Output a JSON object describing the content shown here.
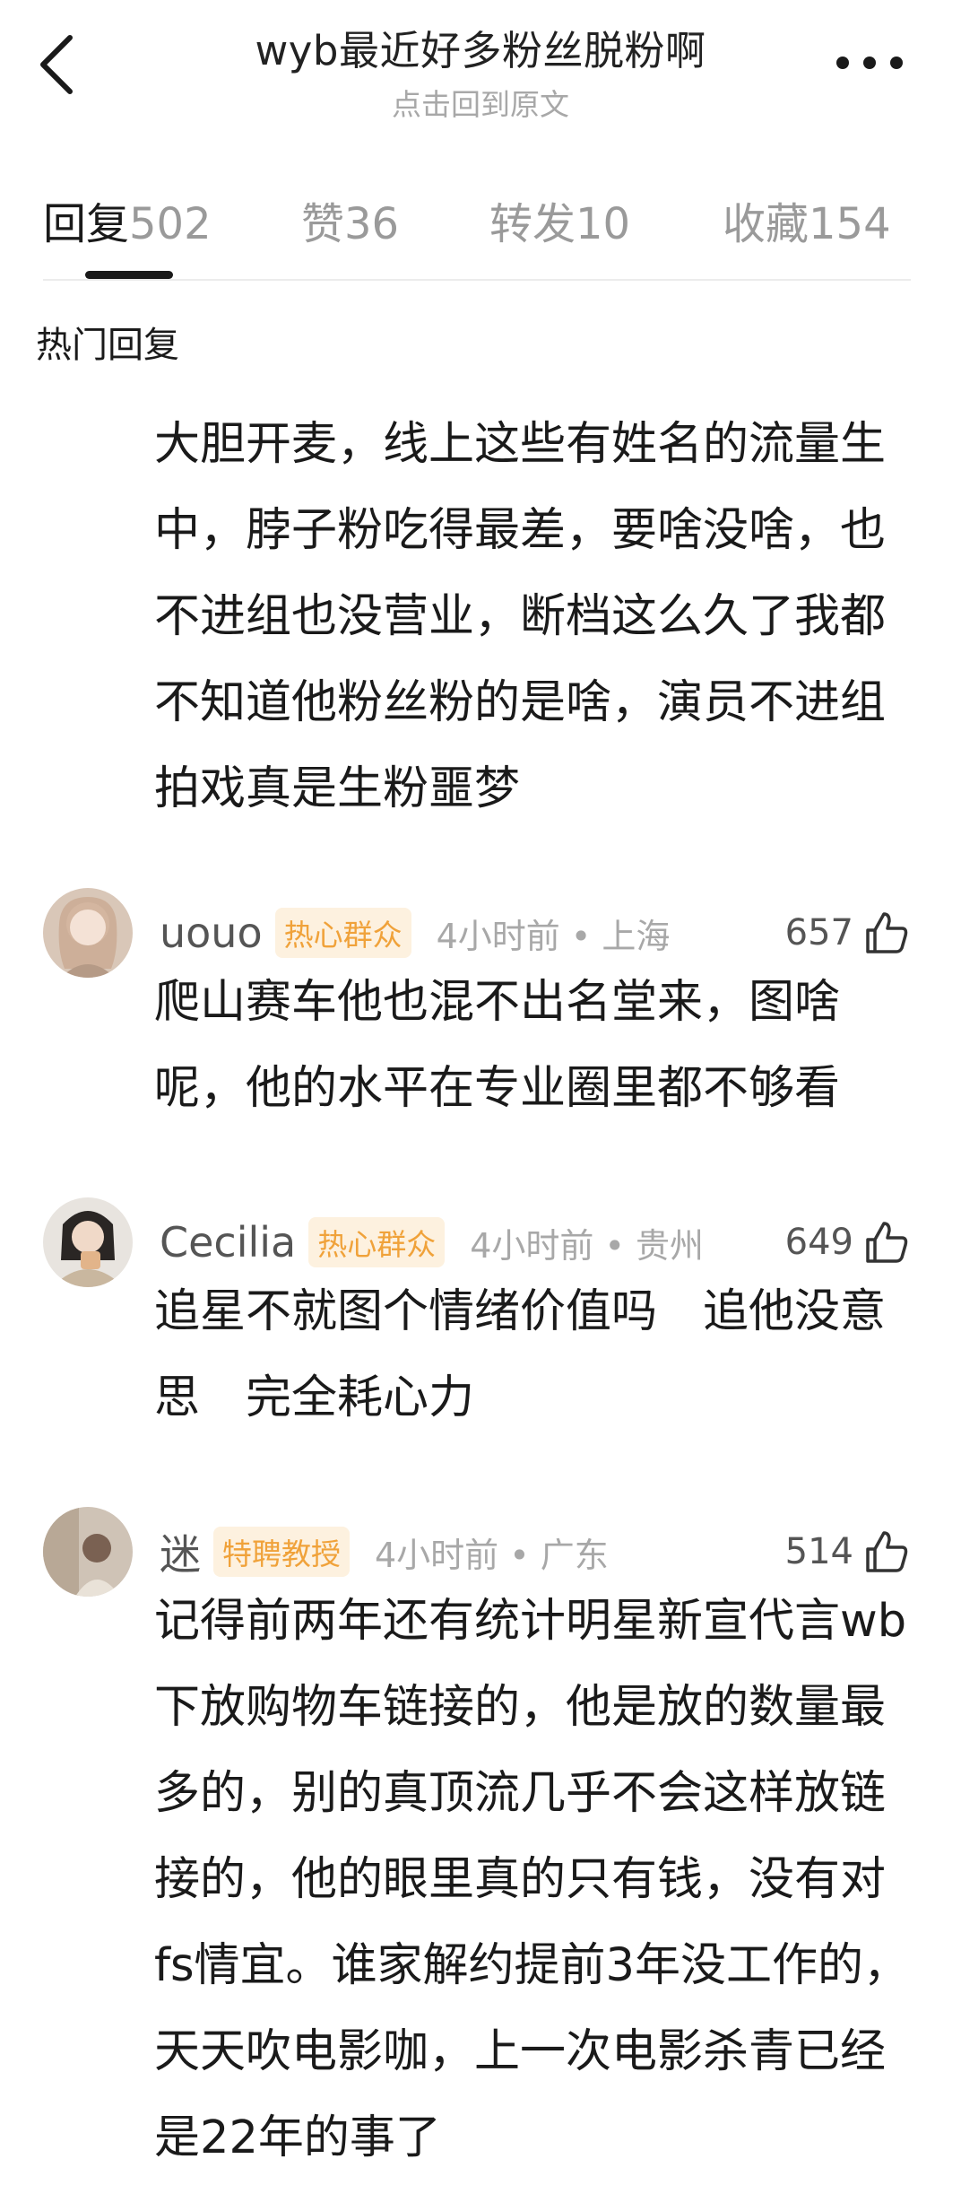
{
  "header": {
    "title": "wyb最近好多粉丝脱粉啊",
    "subtitle": "点击回到原文"
  },
  "tabs": [
    {
      "label": "回复",
      "count": "502",
      "active": true
    },
    {
      "label": "赞",
      "count": "36",
      "active": false
    },
    {
      "label": "转发",
      "count": "10",
      "active": false
    },
    {
      "label": "收藏",
      "count": "154",
      "active": false
    }
  ],
  "section_heading": "热门回复",
  "post_text": "大胆开麦，线上这些有姓名的流量生中，脖子粉吃得最差，要啥没啥，也不进组也没营业，断档这么久了我都不知道他粉丝粉的是啥，演员不进组拍戏真是生粉噩梦",
  "comments": [
    {
      "username": "uouo",
      "badge": "热心群众",
      "time_location": "4小时前 • 上海",
      "likes": "657",
      "text": "爬山赛车他也混不出名堂来，图啥呢，他的水平在专业圈里都不够看"
    },
    {
      "username": "Cecilia",
      "badge": "热心群众",
      "time_location": "4小时前 • 贵州",
      "likes": "649",
      "text": "追星不就图个情绪价值吗　追他没意思　完全耗心力"
    },
    {
      "username": "迷",
      "badge": "特聘教授",
      "time_location": "4小时前 • 广东",
      "likes": "514",
      "text": "记得前两年还有统计明星新宣代言wb下放购物车链接的，他是放的数量最多的，别的真顶流几乎不会这样放链接的，他的眼里真的只有钱，没有对fs情宜。谁家解约提前3年没工作的，天天吹电影咖，上一次电影杀青已经是22年的事了"
    }
  ],
  "colors": {
    "badge_text": "#f0a23a",
    "badge_bg": "#fdf1df",
    "muted": "#a8a8a8"
  },
  "icons": [
    "back-arrow-icon",
    "more-dots-icon",
    "thumbs-up-icon"
  ]
}
